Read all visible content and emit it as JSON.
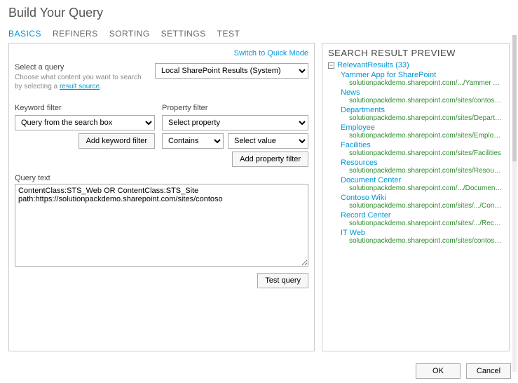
{
  "title": "Build Your Query",
  "tabs": [
    "BASICS",
    "REFINERS",
    "SORTING",
    "SETTINGS",
    "TEST"
  ],
  "active_tab": 0,
  "switch_mode": "Switch to Quick Mode",
  "select_query": {
    "label": "Select a query",
    "desc_pre": "Choose what content you want to search by selecting a ",
    "desc_link": "result source",
    "desc_post": ".",
    "value": "Local SharePoint Results (System)"
  },
  "keyword_filter": {
    "label": "Keyword filter",
    "value": "Query from the search box",
    "add_btn": "Add keyword filter"
  },
  "property_filter": {
    "label": "Property filter",
    "select_property": "Select property",
    "contains": "Contains",
    "select_value": "Select value",
    "add_btn": "Add property filter"
  },
  "query_text": {
    "label": "Query text",
    "value": "ContentClass:STS_Web OR ContentClass:STS_Site\npath:https://solutionpackdemo.sharepoint.com/sites/contoso"
  },
  "test_query_btn": "Test query",
  "preview": {
    "title": "SEARCH RESULT PREVIEW",
    "root_label": "RelevantResults (33)",
    "results": [
      {
        "title": "Yammer App for SharePoint",
        "url": "solutionpackdemo.sharepoint.com/.../Yammer App for Sha..."
      },
      {
        "title": "News",
        "url": "solutionpackdemo.sharepoint.com/sites/contoso/News"
      },
      {
        "title": "Departments",
        "url": "solutionpackdemo.sharepoint.com/sites/Departments"
      },
      {
        "title": "Employee",
        "url": "solutionpackdemo.sharepoint.com/sites/Employee"
      },
      {
        "title": "Facilities",
        "url": "solutionpackdemo.sharepoint.com/sites/Facilities"
      },
      {
        "title": "Resources",
        "url": "solutionpackdemo.sharepoint.com/sites/Resources"
      },
      {
        "title": "Document Center",
        "url": "solutionpackdemo.sharepoint.com/.../Document Center"
      },
      {
        "title": "Contoso Wiki",
        "url": "solutionpackdemo.sharepoint.com/sites/.../ContosoWiki"
      },
      {
        "title": "Record Center",
        "url": "solutionpackdemo.sharepoint.com/sites/.../Record Center"
      },
      {
        "title": "IT Web",
        "url": "solutionpackdemo.sharepoint.com/sites/contoso/ITWeb"
      }
    ]
  },
  "buttons": {
    "ok": "OK",
    "cancel": "Cancel"
  }
}
